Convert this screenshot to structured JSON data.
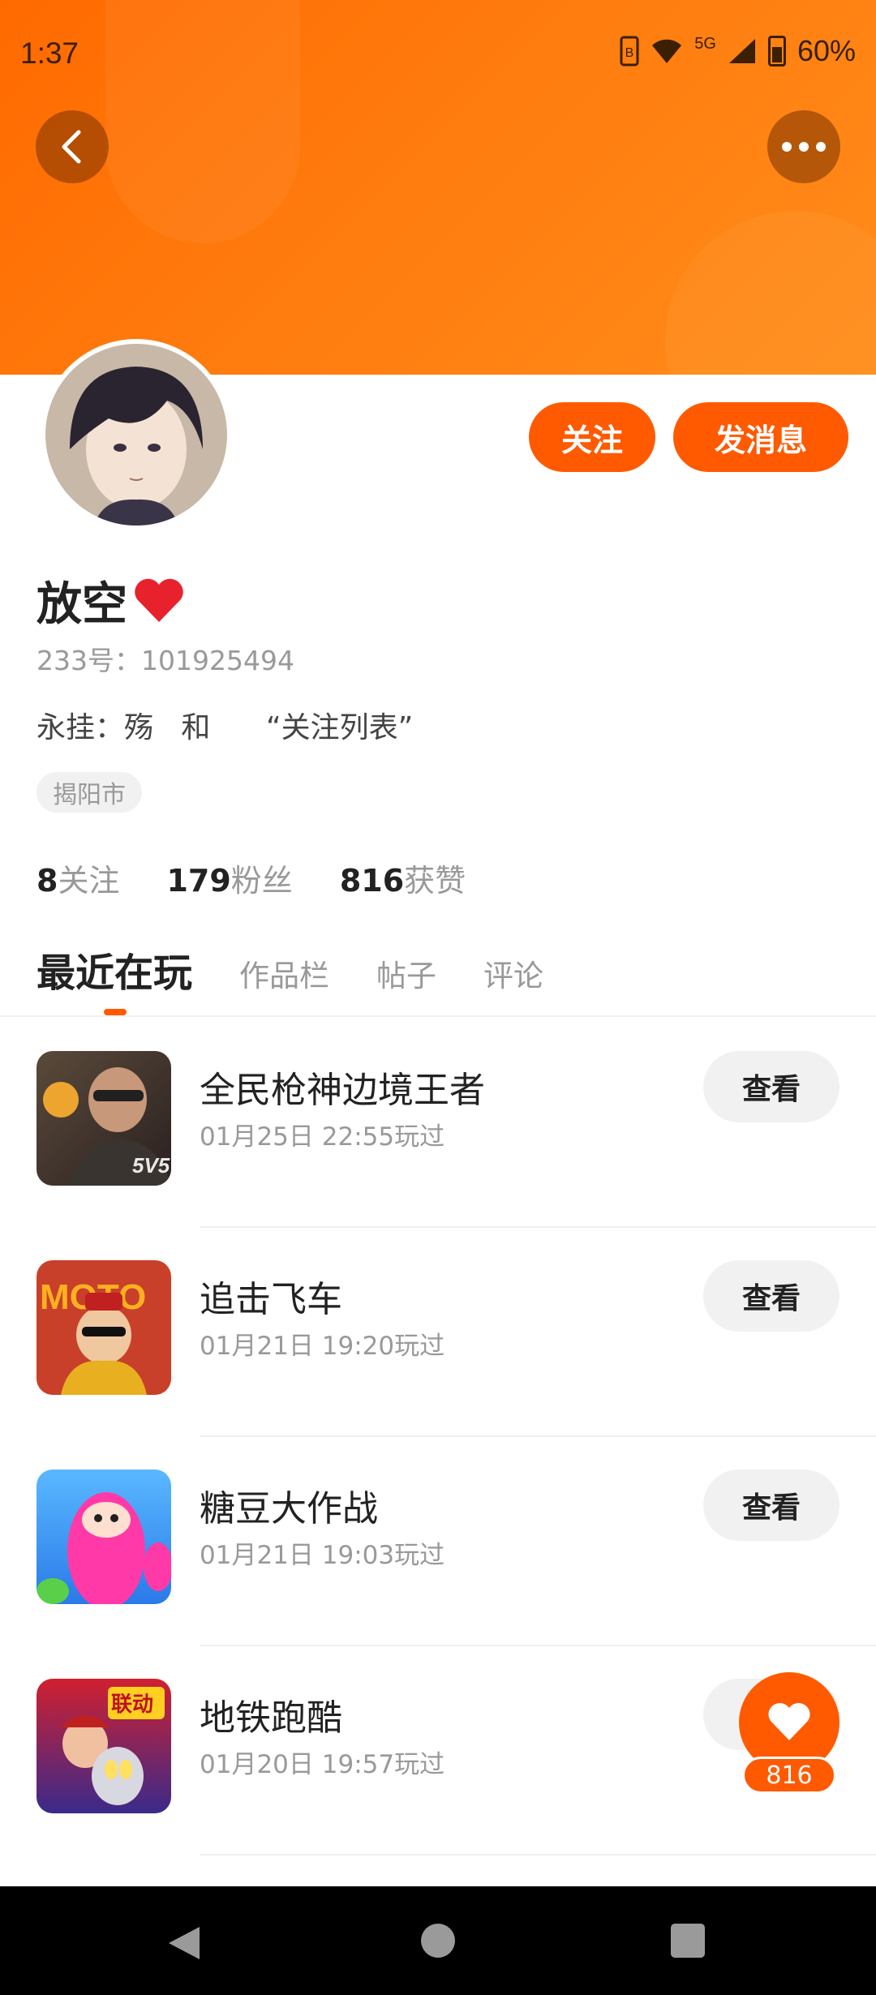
{
  "status_bar": {
    "time": "1:37",
    "network": "5G",
    "battery": "60%"
  },
  "profile": {
    "name": "放空",
    "uid": "233号：101925494",
    "bio": "永挂：殇   和      “关注列表”",
    "location": "揭阳市",
    "follow_label": "关注",
    "message_label": "发消息"
  },
  "stats": [
    {
      "value": "8",
      "label": "关注"
    },
    {
      "value": "179",
      "label": "粉丝"
    },
    {
      "value": "816",
      "label": "获赞"
    }
  ],
  "tabs": [
    {
      "label": "最近在玩",
      "active": true
    },
    {
      "label": "作品栏",
      "active": false
    },
    {
      "label": "帖子",
      "active": false
    },
    {
      "label": "评论",
      "active": false
    }
  ],
  "games": [
    {
      "title": "全民枪神边境王者",
      "time": "01月25日 22:55玩过",
      "button": "查看",
      "icon": "gun-game-icon"
    },
    {
      "title": "追击飞车",
      "time": "01月21日 19:20玩过",
      "button": "查看",
      "icon": "moto-game-icon"
    },
    {
      "title": "糖豆大作战",
      "time": "01月21日 19:03玩过",
      "button": "查看",
      "icon": "bean-game-icon"
    },
    {
      "title": "地铁跑酷",
      "time": "01月20日 19:57玩过",
      "button": "查看",
      "icon": "subway-game-icon"
    }
  ],
  "like_fab": {
    "count": "816"
  },
  "colors": {
    "accent": "#ff5a00",
    "header_gradient_start": "#ff6a00",
    "header_gradient_end": "#ff8c1a"
  }
}
